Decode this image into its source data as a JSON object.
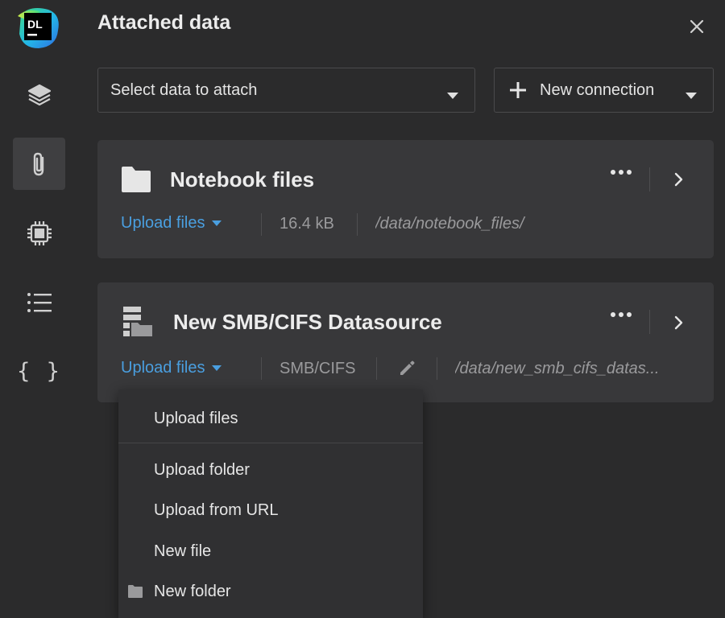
{
  "panel": {
    "title": "Attached data",
    "select_placeholder": "Select data to attach",
    "new_connection_label": "New connection"
  },
  "rail": {
    "logo_text": "DL",
    "items": [
      "layers-icon",
      "paperclip-icon",
      "chip-icon",
      "list-icon",
      "braces-icon"
    ],
    "braces_glyph": "{ }"
  },
  "cards": [
    {
      "title": "Notebook files",
      "icon": "folder-icon",
      "upload_label": "Upload files",
      "size": "16.4 kB",
      "path": "/data/notebook_files/"
    },
    {
      "title": "New SMB/CIFS Datasource",
      "icon": "datasource-icon",
      "upload_label": "Upload files",
      "type": "SMB/CIFS",
      "path": "/data/new_smb_cifs_datas..."
    }
  ],
  "menu": {
    "items": [
      {
        "label": "Upload files"
      },
      {
        "label": "Upload folder"
      },
      {
        "label": "Upload from URL"
      },
      {
        "label": "New file"
      },
      {
        "label": "New folder",
        "icon": "folder-icon"
      }
    ]
  },
  "colors": {
    "background": "#2b2b2c",
    "card": "#38383a",
    "accent_link": "#4a9fe0",
    "menu": "#303032"
  }
}
